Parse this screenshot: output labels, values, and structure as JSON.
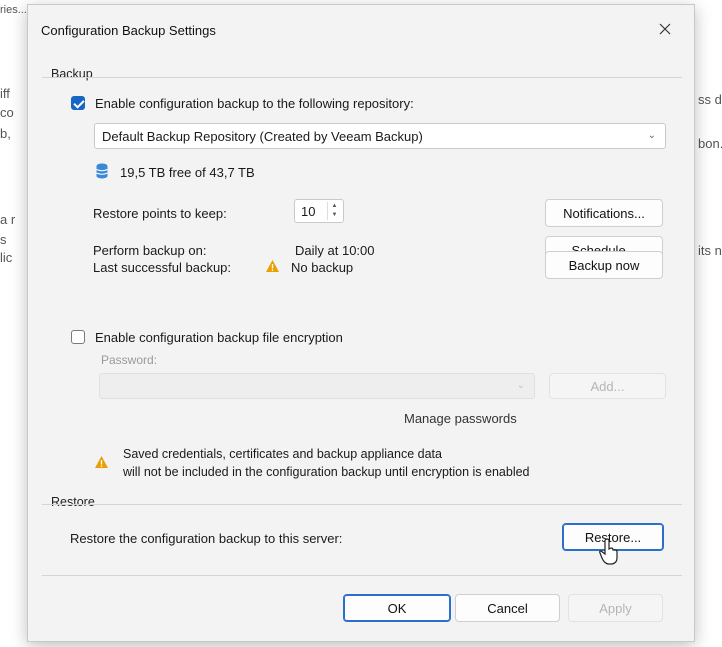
{
  "background": {
    "fragments": [
      "ries...",
      "iff",
      "co",
      "b,",
      "a r",
      "s",
      "lic",
      "ss d",
      "bon.",
      "its na"
    ]
  },
  "dialog": {
    "title": "Configuration Backup Settings",
    "backup": {
      "group_label": "Backup",
      "enable_label": "Enable configuration backup to the following repository:",
      "enabled": true,
      "repository": "Default Backup Repository (Created by Veeam Backup)",
      "free_space": "19,5 TB free of 43,7 TB",
      "restore_points_label": "Restore points to keep:",
      "restore_points_value": "10",
      "notifications_button": "Notifications...",
      "perform_label": "Perform backup on:",
      "perform_value": "Daily at 10:00",
      "schedule_button": "Schedule...",
      "last_label": "Last successful backup:",
      "last_value": "No backup",
      "backup_now_button": "Backup now",
      "encryption_label": "Enable configuration backup file encryption",
      "encryption_enabled": false,
      "password_label": "Password:",
      "add_button": "Add...",
      "manage_passwords": "Manage passwords",
      "warning_line1": "Saved credentials, certificates and backup appliance data",
      "warning_line2": "will not be included in the configuration backup until encryption is enabled"
    },
    "restore": {
      "group_label": "Restore",
      "restore_label": "Restore the configuration backup to this server:",
      "restore_button": "Restore..."
    },
    "footer": {
      "ok": "OK",
      "cancel": "Cancel",
      "apply": "Apply"
    }
  },
  "colors": {
    "accent": "#1766c4",
    "warning": "#e8a000",
    "focus": "#2a6fc9"
  },
  "icons": {
    "close": "close-icon",
    "database": "database-icon",
    "warning": "warning-icon",
    "cursor": "mouse-cursor-icon"
  }
}
